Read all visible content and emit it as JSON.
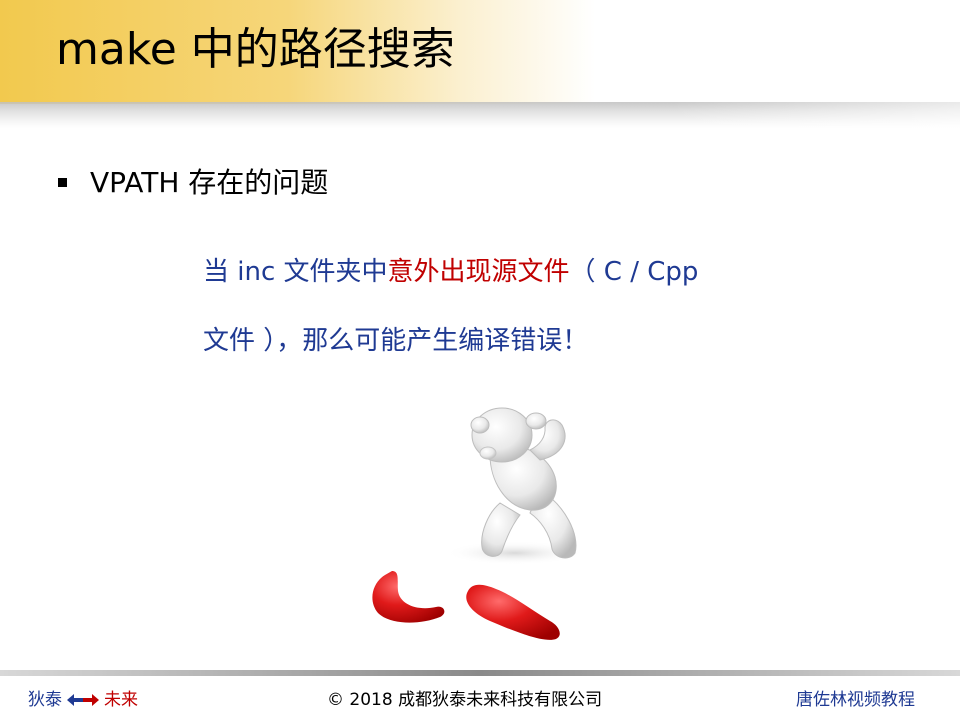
{
  "title": "make 中的路径搜索",
  "bullet": {
    "text": "VPATH 存在的问题"
  },
  "note": {
    "line1_part1": "当 inc 文件夹中",
    "line1_highlight": "意外出现源文件",
    "line1_part2": "（ C / Cpp",
    "line2": "文件 ），那么可能产生编译错误！"
  },
  "illustration": {
    "icon": "worried-figure-broken-pieces"
  },
  "footer": {
    "left_word1": "狄泰",
    "left_word2": "未来",
    "copyright": "© 2018 成都狄泰未来科技有限公司",
    "right": "唐佐林视频教程"
  },
  "colors": {
    "title_accent": "#f2c94e",
    "note_text": "#1f3a93",
    "note_highlight": "#c00000",
    "footer_blue": "#1f3a93",
    "footer_red": "#c00000"
  }
}
